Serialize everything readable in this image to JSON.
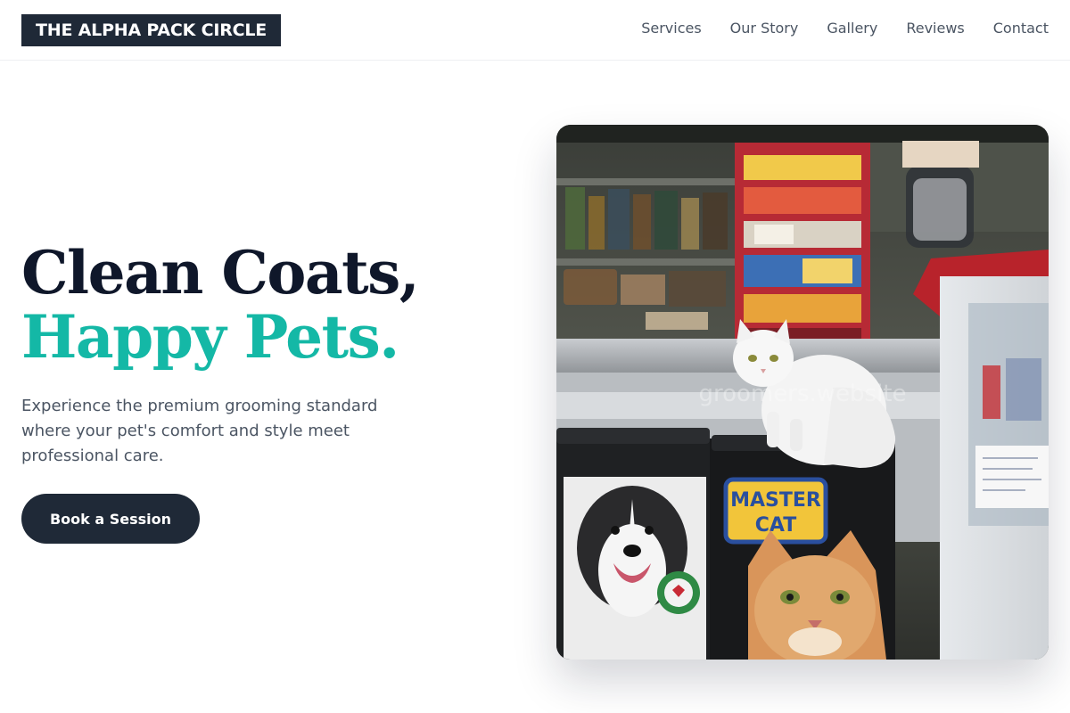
{
  "header": {
    "logo_text": "THE ALPHA PACK CIRCLE",
    "nav": [
      {
        "label": "Services"
      },
      {
        "label": "Our Story"
      },
      {
        "label": "Gallery"
      },
      {
        "label": "Reviews"
      },
      {
        "label": "Contact"
      }
    ]
  },
  "hero": {
    "headline_line1": "Clean Coats,",
    "headline_line2": "Happy Pets.",
    "subtitle": "Experience the premium grooming standard where your pet's comfort and style meet professional care.",
    "cta_label": "Book a Session"
  },
  "photo": {
    "watermark": "groomers.website",
    "bag_label_line1": "MASTER",
    "bag_label_line2": "CAT"
  },
  "colors": {
    "primary_dark": "#1f2937",
    "accent_teal": "#14b8a6",
    "headline_dark": "#0f172a",
    "body_gray": "#4b5563"
  }
}
